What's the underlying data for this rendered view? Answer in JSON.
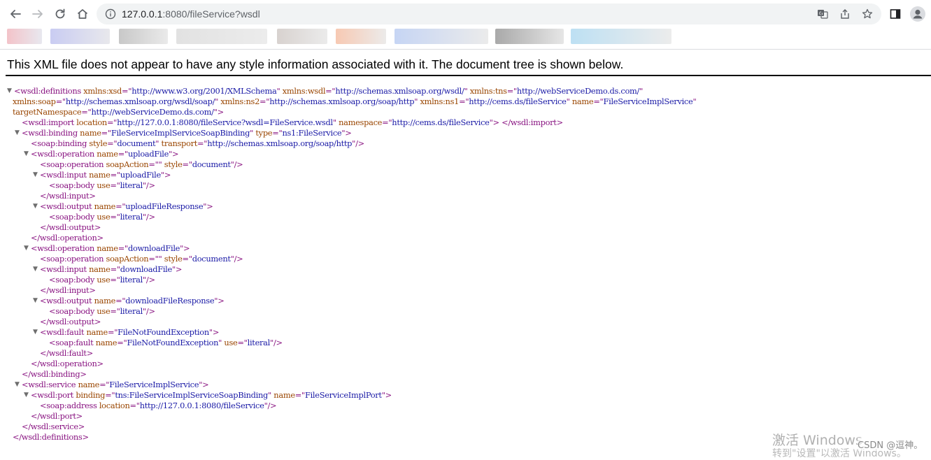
{
  "browser": {
    "url_host": "127.0.0.1",
    "url_port": ":8080",
    "url_path": "/fileService?wsdl"
  },
  "page": {
    "header": "This XML file does not appear to have any style information associated with it. The document tree is shown below."
  },
  "xml_lines": [
    {
      "indent": 0,
      "toggle": "▼",
      "parts": [
        [
          "t",
          "<wsdl:definitions "
        ],
        [
          "a",
          "xmlns:xsd"
        ],
        [
          "t",
          "=\""
        ],
        [
          "v",
          "http://www.w3.org/2001/XMLSchema"
        ],
        [
          "t",
          "\" "
        ],
        [
          "a",
          "xmlns:wsdl"
        ],
        [
          "t",
          "=\""
        ],
        [
          "v",
          "http://schemas.xmlsoap.org/wsdl/"
        ],
        [
          "t",
          "\" "
        ],
        [
          "a",
          "xmlns:tns"
        ],
        [
          "t",
          "=\""
        ],
        [
          "v",
          "http://webServiceDemo.ds.com/"
        ],
        [
          "t",
          "\""
        ]
      ]
    },
    {
      "indent": 1,
      "toggle": "",
      "parts": [
        [
          "a",
          "xmlns:soap"
        ],
        [
          "t",
          "=\""
        ],
        [
          "v",
          "http://schemas.xmlsoap.org/wsdl/soap/"
        ],
        [
          "t",
          "\" "
        ],
        [
          "a",
          "xmlns:ns2"
        ],
        [
          "t",
          "=\""
        ],
        [
          "v",
          "http://schemas.xmlsoap.org/soap/http"
        ],
        [
          "t",
          "\" "
        ],
        [
          "a",
          "xmlns:ns1"
        ],
        [
          "t",
          "=\""
        ],
        [
          "v",
          "http://cems.ds/fileService"
        ],
        [
          "t",
          "\" "
        ],
        [
          "a",
          "name"
        ],
        [
          "t",
          "=\""
        ],
        [
          "v",
          "FileServiceImplService"
        ],
        [
          "t",
          "\""
        ]
      ]
    },
    {
      "indent": 1,
      "toggle": "",
      "parts": [
        [
          "a",
          "targetNamespace"
        ],
        [
          "t",
          "=\""
        ],
        [
          "v",
          "http://webServiceDemo.ds.com/"
        ],
        [
          "t",
          "\">"
        ]
      ]
    },
    {
      "indent": 2,
      "toggle": "",
      "parts": [
        [
          "t",
          "<wsdl:import "
        ],
        [
          "a",
          "location"
        ],
        [
          "t",
          "=\""
        ],
        [
          "v",
          "http://127.0.0.1:8080/fileService?wsdl=FileService.wsdl"
        ],
        [
          "t",
          "\" "
        ],
        [
          "a",
          "namespace"
        ],
        [
          "t",
          "=\""
        ],
        [
          "v",
          "http://cems.ds/fileService"
        ],
        [
          "t",
          "\"> </wsdl:import>"
        ]
      ]
    },
    {
      "indent": 2,
      "toggle": "▼",
      "parts": [
        [
          "t",
          "<wsdl:binding "
        ],
        [
          "a",
          "name"
        ],
        [
          "t",
          "=\""
        ],
        [
          "v",
          "FileServiceImplServiceSoapBinding"
        ],
        [
          "t",
          "\" "
        ],
        [
          "a",
          "type"
        ],
        [
          "t",
          "=\""
        ],
        [
          "v",
          "ns1:FileService"
        ],
        [
          "t",
          "\">"
        ]
      ]
    },
    {
      "indent": 3,
      "toggle": "",
      "parts": [
        [
          "t",
          "<soap:binding "
        ],
        [
          "a",
          "style"
        ],
        [
          "t",
          "=\""
        ],
        [
          "v",
          "document"
        ],
        [
          "t",
          "\" "
        ],
        [
          "a",
          "transport"
        ],
        [
          "t",
          "=\""
        ],
        [
          "v",
          "http://schemas.xmlsoap.org/soap/http"
        ],
        [
          "t",
          "\"/>"
        ]
      ]
    },
    {
      "indent": 3,
      "toggle": "▼",
      "parts": [
        [
          "t",
          "<wsdl:operation "
        ],
        [
          "a",
          "name"
        ],
        [
          "t",
          "=\""
        ],
        [
          "v",
          "uploadFile"
        ],
        [
          "t",
          "\">"
        ]
      ]
    },
    {
      "indent": 4,
      "toggle": "",
      "parts": [
        [
          "t",
          "<soap:operation "
        ],
        [
          "a",
          "soapAction"
        ],
        [
          "t",
          "=\""
        ],
        [
          "v",
          ""
        ],
        [
          "t",
          "\" "
        ],
        [
          "a",
          "style"
        ],
        [
          "t",
          "=\""
        ],
        [
          "v",
          "document"
        ],
        [
          "t",
          "\"/>"
        ]
      ]
    },
    {
      "indent": 4,
      "toggle": "▼",
      "parts": [
        [
          "t",
          "<wsdl:input "
        ],
        [
          "a",
          "name"
        ],
        [
          "t",
          "=\""
        ],
        [
          "v",
          "uploadFile"
        ],
        [
          "t",
          "\">"
        ]
      ]
    },
    {
      "indent": 5,
      "toggle": "",
      "parts": [
        [
          "t",
          "<soap:body "
        ],
        [
          "a",
          "use"
        ],
        [
          "t",
          "=\""
        ],
        [
          "v",
          "literal"
        ],
        [
          "t",
          "\"/>"
        ]
      ]
    },
    {
      "indent": 4,
      "toggle": "",
      "parts": [
        [
          "t",
          "</wsdl:input>"
        ]
      ]
    },
    {
      "indent": 4,
      "toggle": "▼",
      "parts": [
        [
          "t",
          "<wsdl:output "
        ],
        [
          "a",
          "name"
        ],
        [
          "t",
          "=\""
        ],
        [
          "v",
          "uploadFileResponse"
        ],
        [
          "t",
          "\">"
        ]
      ]
    },
    {
      "indent": 5,
      "toggle": "",
      "parts": [
        [
          "t",
          "<soap:body "
        ],
        [
          "a",
          "use"
        ],
        [
          "t",
          "=\""
        ],
        [
          "v",
          "literal"
        ],
        [
          "t",
          "\"/>"
        ]
      ]
    },
    {
      "indent": 4,
      "toggle": "",
      "parts": [
        [
          "t",
          "</wsdl:output>"
        ]
      ]
    },
    {
      "indent": 3,
      "toggle": "",
      "parts": [
        [
          "t",
          "</wsdl:operation>"
        ]
      ]
    },
    {
      "indent": 3,
      "toggle": "▼",
      "parts": [
        [
          "t",
          "<wsdl:operation "
        ],
        [
          "a",
          "name"
        ],
        [
          "t",
          "=\""
        ],
        [
          "v",
          "downloadFile"
        ],
        [
          "t",
          "\">"
        ]
      ]
    },
    {
      "indent": 4,
      "toggle": "",
      "parts": [
        [
          "t",
          "<soap:operation "
        ],
        [
          "a",
          "soapAction"
        ],
        [
          "t",
          "=\""
        ],
        [
          "v",
          ""
        ],
        [
          "t",
          "\" "
        ],
        [
          "a",
          "style"
        ],
        [
          "t",
          "=\""
        ],
        [
          "v",
          "document"
        ],
        [
          "t",
          "\"/>"
        ]
      ]
    },
    {
      "indent": 4,
      "toggle": "▼",
      "parts": [
        [
          "t",
          "<wsdl:input "
        ],
        [
          "a",
          "name"
        ],
        [
          "t",
          "=\""
        ],
        [
          "v",
          "downloadFile"
        ],
        [
          "t",
          "\">"
        ]
      ]
    },
    {
      "indent": 5,
      "toggle": "",
      "parts": [
        [
          "t",
          "<soap:body "
        ],
        [
          "a",
          "use"
        ],
        [
          "t",
          "=\""
        ],
        [
          "v",
          "literal"
        ],
        [
          "t",
          "\"/>"
        ]
      ]
    },
    {
      "indent": 4,
      "toggle": "",
      "parts": [
        [
          "t",
          "</wsdl:input>"
        ]
      ]
    },
    {
      "indent": 4,
      "toggle": "▼",
      "parts": [
        [
          "t",
          "<wsdl:output "
        ],
        [
          "a",
          "name"
        ],
        [
          "t",
          "=\""
        ],
        [
          "v",
          "downloadFileResponse"
        ],
        [
          "t",
          "\">"
        ]
      ]
    },
    {
      "indent": 5,
      "toggle": "",
      "parts": [
        [
          "t",
          "<soap:body "
        ],
        [
          "a",
          "use"
        ],
        [
          "t",
          "=\""
        ],
        [
          "v",
          "literal"
        ],
        [
          "t",
          "\"/>"
        ]
      ]
    },
    {
      "indent": 4,
      "toggle": "",
      "parts": [
        [
          "t",
          "</wsdl:output>"
        ]
      ]
    },
    {
      "indent": 4,
      "toggle": "▼",
      "parts": [
        [
          "t",
          "<wsdl:fault "
        ],
        [
          "a",
          "name"
        ],
        [
          "t",
          "=\""
        ],
        [
          "v",
          "FileNotFoundException"
        ],
        [
          "t",
          "\">"
        ]
      ]
    },
    {
      "indent": 5,
      "toggle": "",
      "parts": [
        [
          "t",
          "<soap:fault "
        ],
        [
          "a",
          "name"
        ],
        [
          "t",
          "=\""
        ],
        [
          "v",
          "FileNotFoundException"
        ],
        [
          "t",
          "\" "
        ],
        [
          "a",
          "use"
        ],
        [
          "t",
          "=\""
        ],
        [
          "v",
          "literal"
        ],
        [
          "t",
          "\"/>"
        ]
      ]
    },
    {
      "indent": 4,
      "toggle": "",
      "parts": [
        [
          "t",
          "</wsdl:fault>"
        ]
      ]
    },
    {
      "indent": 3,
      "toggle": "",
      "parts": [
        [
          "t",
          "</wsdl:operation>"
        ]
      ]
    },
    {
      "indent": 2,
      "toggle": "",
      "parts": [
        [
          "t",
          "</wsdl:binding>"
        ]
      ]
    },
    {
      "indent": 2,
      "toggle": "▼",
      "parts": [
        [
          "t",
          "<wsdl:service "
        ],
        [
          "a",
          "name"
        ],
        [
          "t",
          "=\""
        ],
        [
          "v",
          "FileServiceImplService"
        ],
        [
          "t",
          "\">"
        ]
      ]
    },
    {
      "indent": 3,
      "toggle": "▼",
      "parts": [
        [
          "t",
          "<wsdl:port "
        ],
        [
          "a",
          "binding"
        ],
        [
          "t",
          "=\""
        ],
        [
          "v",
          "tns:FileServiceImplServiceSoapBinding"
        ],
        [
          "t",
          "\" "
        ],
        [
          "a",
          "name"
        ],
        [
          "t",
          "=\""
        ],
        [
          "v",
          "FileServiceImplPort"
        ],
        [
          "t",
          "\">"
        ]
      ]
    },
    {
      "indent": 4,
      "toggle": "",
      "parts": [
        [
          "t",
          "<soap:address "
        ],
        [
          "a",
          "location"
        ],
        [
          "t",
          "=\""
        ],
        [
          "v",
          "http://127.0.0.1:8080/fileService"
        ],
        [
          "t",
          "\"/>"
        ]
      ]
    },
    {
      "indent": 3,
      "toggle": "",
      "parts": [
        [
          "t",
          "</wsdl:port>"
        ]
      ]
    },
    {
      "indent": 2,
      "toggle": "",
      "parts": [
        [
          "t",
          "</wsdl:service>"
        ]
      ]
    },
    {
      "indent": 1,
      "toggle": "",
      "parts": [
        [
          "t",
          "</wsdl:definitions>"
        ]
      ]
    }
  ],
  "overlay": {
    "activate_windows": "激活 Windows",
    "activate_windows_sub": "转到\"设置\"以激活 Windows。",
    "csdn": "CSDN @逗神。"
  },
  "colors": {
    "tag": "#881280",
    "attr": "#994500",
    "value": "#1a1aa6"
  }
}
